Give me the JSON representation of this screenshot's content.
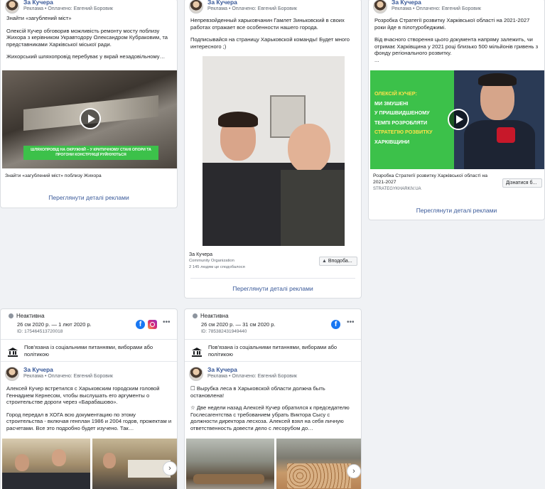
{
  "card1": {
    "page_name": "За Кучера",
    "sponsor": "Реклама • Оплачено: Евгений Боровик",
    "paragraphs": [
      "Знайти «загублений міст»",
      "Олексій Кучер обговорив можливість ремонту мосту поблизу Жихора з керівником Укравтодору Олександром Кубраковим, та представниками Харківської міської ради.",
      "Жихорський шляхопровід перебуває у вкрай незадовільному…"
    ],
    "video_banner": "ШЛЯХОПРОВІД НА ОКРУЖНІЙ – У КРИТИЧНОМУ СТАНІ ОПОРИ ТА ПРОГОНИ КОНСТРУКЦІЇ РУЙНУЮТЬСЯ",
    "caption": "Знайти «загублений міст» поблизу Жихора",
    "details_link": "Переглянути деталі реклами"
  },
  "card2": {
    "page_name": "За Кучера",
    "sponsor": "Реклама • Оплачено: Евгений Боровик",
    "paragraphs": [
      "Непревзойденный харьковчанин Гамлет Зиньковский в своих работах отражает все особенности нашего города.",
      "Подписывайся на страницу Харьковской команды! Будет много интересного ;)"
    ],
    "footer_name": "За Кучера",
    "footer_category": "Community Organization",
    "footer_likes": "2 145 людям це сподобалося",
    "like_button": "Вподоба...",
    "details_link": "Переглянути деталі реклами"
  },
  "card3": {
    "page_name": "За Кучера",
    "sponsor": "Реклама • Оплачено: Евгений Боровик",
    "paragraphs": [
      "Розробка Стратегії розвитку Харківської області на 2021-2027 роки йде в пілотуробеджимі.",
      "Від вчасного створення цього документа напряму залежить, чи отримає Харківщина у 2021 році близько 500 мільйонів гривень з фонду регіонального розвитку.",
      "..."
    ],
    "banner_lines": [
      "ОЛЕКСІЙ КУЧЕР:",
      "МИ ЗМУШЕНІ",
      "У ПРИШВИДШЕНОМУ",
      "ТЕМПІ РОЗРОБЛЯТИ"
    ],
    "banner_highlight": "СТРАТЕГІЮ РОЗВИТКУ",
    "banner_last": "ХАРКІВЩИНИ",
    "link_title": "Розробка Стратегії розвитку Харківської області на 2021-2027",
    "link_domain": "STRATEGYKHARKIV.UA",
    "cta": "Дізнатися б...",
    "details_link": "Переглянути деталі реклами"
  },
  "card4": {
    "status": "Неактивна",
    "dates": "26 см 2020 р. — 1 лют 2020 р.",
    "ad_id": "ID: 175464513720018",
    "category": "Пов'язана із соціальними питаннями, виборами або політикою",
    "page_name": "За Кучера",
    "sponsor": "Реклама • Оплачено: Евгений Боровик",
    "paragraphs": [
      "Алексей Кучер встретился с Харьковским городским головой Геннадием Кернесом, чтобы выслушать его аргументы о строительстве дороги через «Барабашово».",
      "Город передал в ХОГА всю документацию по этому строительства - включая генплан 1986 и 2004 годов, прожектам и расчетами. Все это подробно будет изучено. Так…"
    ]
  },
  "card5": {
    "status": "Неактивна",
    "dates": "26 см 2020 р. — 31 см 2020 р.",
    "ad_id": "ID: 785382431949440",
    "category": "Пов'язана із соціальними питаннями, виборами або політикою",
    "page_name": "За Кучера",
    "sponsor": "Реклама • Оплачено: Евгений Боровик",
    "paragraphs": [
      "☐ Вырубка леса в Харьковской области должна быть остановлена!",
      "☆ Две недели назад Алексей Кучер обратился к председателю Гослесагентства с требованием убрать Виктора Сысу с должности директора лесхоза. Алексей взял на себя личную ответственность довести дело с лесорубом до…"
    ]
  },
  "icons": {
    "play": "play-icon",
    "facebook": "facebook-icon",
    "instagram": "instagram-icon",
    "more": "more-icon",
    "politics": "bank-icon",
    "next": "chevron-right-icon",
    "like": "thumbs-up-icon"
  },
  "colors": {
    "link": "#385898",
    "facebook": "#1877f2",
    "green": "#3cc14a"
  }
}
